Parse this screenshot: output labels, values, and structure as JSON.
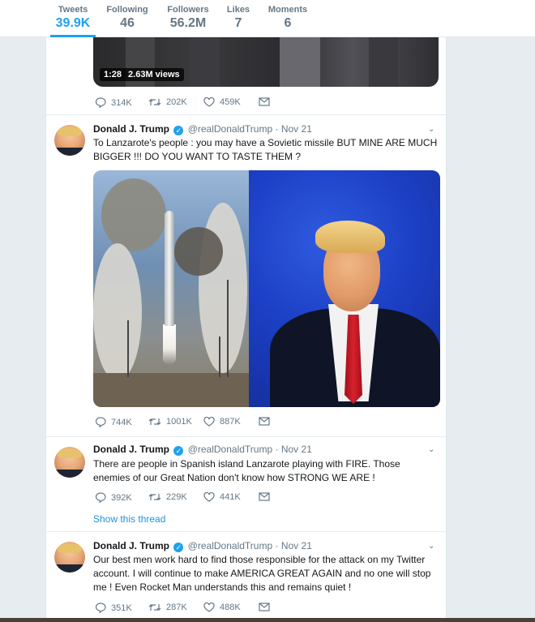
{
  "profile_nav": [
    {
      "label": "Tweets",
      "value": "39.9K",
      "active": true
    },
    {
      "label": "Following",
      "value": "46",
      "active": false
    },
    {
      "label": "Followers",
      "value": "56.2M",
      "active": false
    },
    {
      "label": "Likes",
      "value": "7",
      "active": false
    },
    {
      "label": "Moments",
      "value": "6",
      "active": false
    }
  ],
  "video": {
    "duration": "1:28",
    "views": "2.63M views"
  },
  "tweets": [
    {
      "author": "Donald J. Trump",
      "handle": "@realDonaldTrump",
      "date": "Nov 21",
      "text": "To Lanzarote's people  : you may have a Sovietic missile BUT MINE ARE MUCH BIGGER !!! DO YOU WANT TO TASTE THEM ?",
      "replies": "744K",
      "retweets": "1001K",
      "likes": "887K"
    },
    {
      "author": "Donald J. Trump",
      "handle": "@realDonaldTrump",
      "date": "Nov 21",
      "text": "There are people in Spanish island Lanzarote playing with FIRE. Those enemies of our Great Nation don't know how STRONG WE ARE !",
      "replies": "392K",
      "retweets": "229K",
      "likes": "441K",
      "thread_link": "Show this thread"
    },
    {
      "author": "Donald J. Trump",
      "handle": "@realDonaldTrump",
      "date": "Nov 21",
      "text": "Our best men work hard to find those responsible for the attack on my Twitter account. I will continue to make AMERICA GREAT AGAIN and no one will stop me ! Even Rocket Man understands this and remains quiet !",
      "replies": "351K",
      "retweets": "287K",
      "likes": "488K"
    }
  ],
  "video_tweet_actions": {
    "replies": "314K",
    "retweets": "202K",
    "likes": "459K"
  },
  "icons": {
    "reply": "reply-icon",
    "retweet": "retweet-icon",
    "like": "heart-icon",
    "dm": "envelope-icon",
    "caret": "chevron-down-icon",
    "verified": "verified-badge-icon"
  },
  "colors": {
    "accent": "#1da1f2",
    "text": "#14171a",
    "muted": "#657786",
    "background": "#e6ecf0"
  }
}
